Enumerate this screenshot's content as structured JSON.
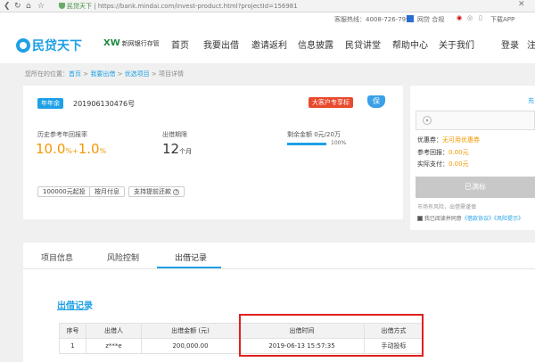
{
  "browser": {
    "site_name": "民贷天下",
    "url": "https://bank.mindai.com/invest-product.html?projectId=156981",
    "close_symbol": "✕"
  },
  "topbar": {
    "hotline": "客服热线：4008-726-799",
    "checkin": "网贷 合规",
    "download": "下载APP"
  },
  "header": {
    "logo_text": "民贷天下",
    "bank_badge_short": "XW",
    "bank_badge_text": "新网银行存管",
    "menu": [
      "首页",
      "我要出借",
      "邀请返利",
      "信息披露",
      "民贷讲堂",
      "帮助中心",
      "关于我们"
    ],
    "login": "登录",
    "register_partial": "注"
  },
  "breadcrumb": {
    "prefix": "您所在的位置：",
    "home": "首页",
    "sep1": ">",
    "invest": "我要出借",
    "sep2": ">",
    "selected": "优选项目",
    "sep3": ">",
    "current": "项目详情"
  },
  "product": {
    "type_tag": "年年余",
    "code": "201906130476号",
    "badge_big": "大客户专享标",
    "badge_shield": "保",
    "rate_label": "历史参考年回报率",
    "rate_base": "10.0",
    "rate_plus": "+",
    "rate_extra": "1.0",
    "rate_unit": "%",
    "term_label": "出借期限",
    "term_value": "12",
    "term_unit": "个月",
    "remain_label": "剩余金额 0元/20万",
    "progress_pct_label": "100%",
    "progress_fraction": 1.0,
    "options": [
      "100000元起投",
      "按月付息",
      "支持提前还款"
    ],
    "help_icon": "?"
  },
  "sidebar": {
    "top_link_partial": "充",
    "coupon_label": "优惠券：",
    "coupon_value": "无可用优惠券",
    "ref_return_label": "参考回报：",
    "ref_return_value": "0.00元",
    "actual_pay_label": "实际支付：",
    "actual_pay_value": "0.00元",
    "full_button": "已满标",
    "risk_text": "市场有风险，出借需谨慎",
    "agree_prefix": "我已阅读并同意",
    "agree_link1": "《借款协议》",
    "agree_link2": "《风险提示》"
  },
  "tabs": [
    "项目信息",
    "风险控制",
    "出借记录"
  ],
  "record": {
    "title": "出借记录",
    "columns": [
      "序号",
      "出借人",
      "出借金额 (元)",
      "出借时间",
      "出借方式"
    ],
    "rows": [
      [
        "1",
        "z***e",
        "200,000.00",
        "2019-06-13 15:57:35",
        "手动投标"
      ]
    ]
  },
  "colors": {
    "brand": "#1ea0e6",
    "rate": "#f39800",
    "highlight_box": "#e02020"
  }
}
